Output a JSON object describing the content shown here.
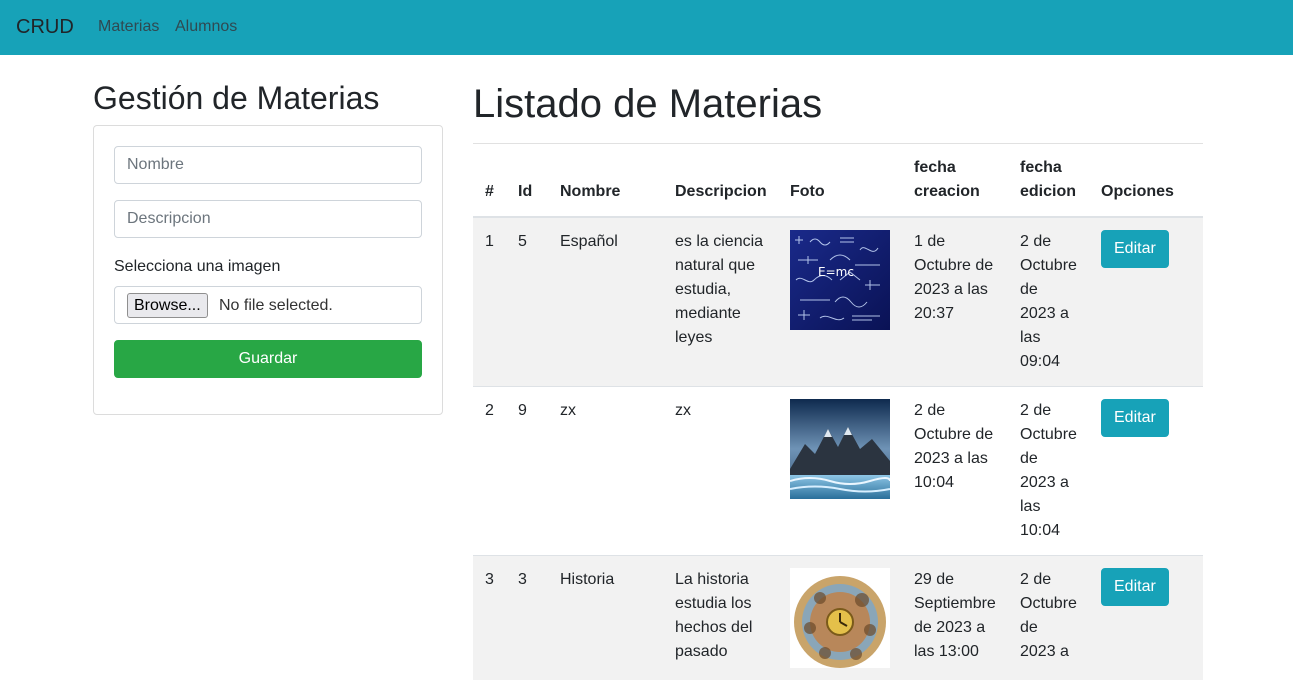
{
  "navbar": {
    "brand": "CRUD",
    "links": [
      "Materias",
      "Alumnos"
    ],
    "color": "#17a2b8"
  },
  "form": {
    "title": "Gestión de Materias",
    "nombre_placeholder": "Nombre",
    "descripcion_placeholder": "Descripcion",
    "image_label": "Selecciona una imagen",
    "browse_label": "Browse...",
    "file_status": "No file selected.",
    "save_label": "Guardar",
    "save_color": "#28a745"
  },
  "list": {
    "title": "Listado de Materias",
    "headers": [
      "#",
      "Id",
      "Nombre",
      "Descripcion",
      "Foto",
      "fecha creacion",
      "fecha edicion",
      "Opciones"
    ],
    "rows": [
      {
        "num": "1",
        "id": "5",
        "nombre": "Español",
        "descripcion": "es la ciencia natural que estudia, mediante leyes",
        "foto": "formulas-blackboard-image",
        "creacion": "1 de Octubre de 2023 a las 20:37",
        "edicion": "2 de Octubre de 2023 a las 09:04",
        "accion": "Editar"
      },
      {
        "num": "2",
        "id": "9",
        "nombre": "zx",
        "descripcion": "zx",
        "foto": "mountain-river-image",
        "creacion": "2 de Octubre de 2023 a las 10:04",
        "edicion": "2 de Octubre de 2023 a las 10:04",
        "accion": "Editar"
      },
      {
        "num": "3",
        "id": "3",
        "nombre": "Historia",
        "descripcion": "La historia estudia los hechos del pasado",
        "foto": "history-clock-illustration",
        "creacion": "29 de Septiembre de 2023 a las 13:00",
        "edicion": "2 de Octubre de 2023 a",
        "accion": "Editar"
      }
    ]
  }
}
